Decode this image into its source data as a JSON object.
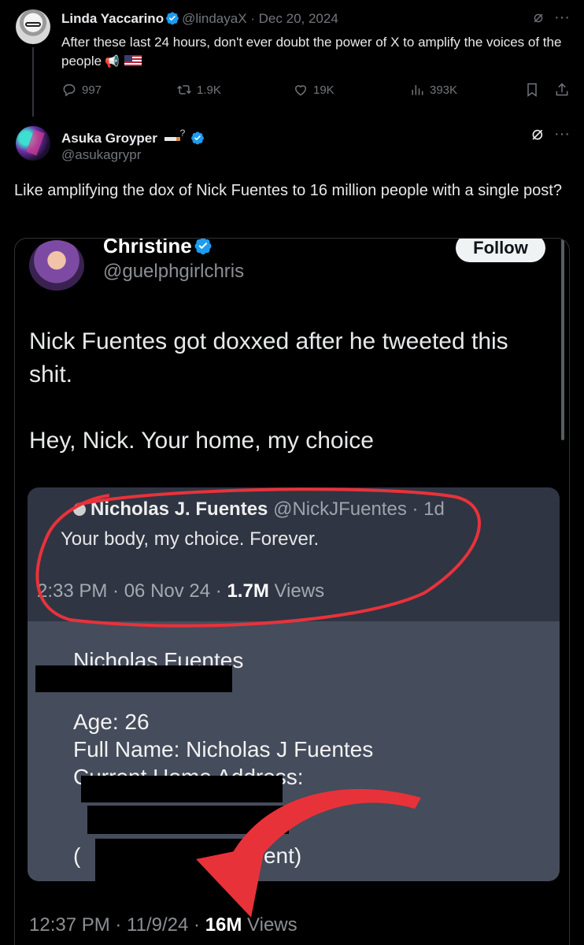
{
  "tweet1": {
    "name": "Linda Yaccarino",
    "handle_date": "@lindayaX · Dec 20, 2024",
    "text": "After these last 24 hours, don't ever doubt the power of X to amplify the voices of the people",
    "replies": "997",
    "reposts": "1.9K",
    "likes": "19K",
    "views": "393K"
  },
  "tweet2": {
    "name": "Asuka Groyper",
    "handle": "@asukagrypr",
    "text": "Like amplifying the dox of Nick Fuentes to 16 million people with a single post?"
  },
  "embedded": {
    "name": "Christine",
    "handle": "@guelphgirlchris",
    "follow_label": "Follow",
    "line1": "Nick Fuentes got doxxed after he tweeted this shit.",
    "line2": "Hey, Nick. Your home, my choice",
    "footer_time": "12:37 PM · 11/9/24 · ",
    "footer_views_count": "16M",
    "footer_views_label": " Views"
  },
  "screenshot": {
    "quoted_name": "Nicholas J. Fuentes",
    "quoted_handle": "@NickJFuentes · 1d",
    "quoted_text": "Your body, my choice. Forever.",
    "meta_time": "2:33 PM · 06 Nov 24 · ",
    "meta_views_count": "1.7M",
    "meta_views_label": " Views",
    "doc_name": "Nicholas Fuentes",
    "age": "Age: 26",
    "full_name": "Full Name: Nicholas J Fuentes",
    "address_label": "Current Home Address:",
    "current_open": "(",
    "current_tail": "rrent)"
  },
  "colors": {
    "background": "#000000",
    "verified": "#1d9bf0",
    "annotation_red": "#e8323a"
  }
}
